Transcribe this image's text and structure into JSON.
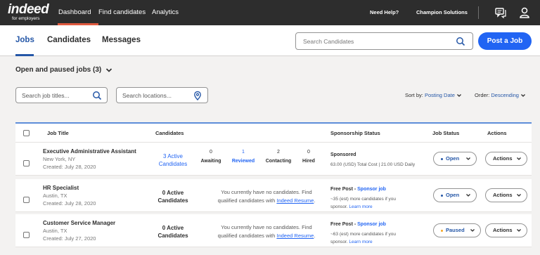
{
  "nav": {
    "logo_main": "indeed",
    "logo_sub": "for employers",
    "links": [
      "Dashboard",
      "Find candidates",
      "Analytics"
    ],
    "need_help": "Need Help?",
    "company": "Champion Solutions",
    "icons": [
      "chat-icon",
      "user-icon"
    ]
  },
  "header": {
    "tabs": [
      "Jobs",
      "Candidates",
      "Messages"
    ],
    "search_placeholder": "Search Candidates",
    "post_job": "Post a Job"
  },
  "filters": {
    "heading": "Open and paused jobs (3)",
    "job_title_placeholder": "Search job titles...",
    "location_placeholder": "Search locations...",
    "sort_label": "Sort by:",
    "sort_value": "Posting Date",
    "order_label": "Order:",
    "order_value": "Descending"
  },
  "table": {
    "columns": [
      "Job Title",
      "Candidates",
      "Sponsorship Status",
      "Job Status",
      "Actions"
    ],
    "rows": [
      {
        "title": "Executive Administrative Assistant",
        "location": "New York, NY",
        "created": "Created: July 28, 2020",
        "candidates_line1": "3 Active",
        "candidates_line2": "Candidates",
        "stats": [
          {
            "num": "0",
            "label": "Awaiting"
          },
          {
            "num": "1",
            "label": "Reviewed"
          },
          {
            "num": "2",
            "label": "Contacting"
          },
          {
            "num": "0",
            "label": "Hired"
          }
        ],
        "sponsorship_title": "Sponsored",
        "sponsorship_detail": "63.00 (USD) Total Cost | 21.00 USD Daily",
        "status": "Open",
        "actions": "Actions"
      },
      {
        "title": "HR Specialist",
        "location": "Austin, TX",
        "created": "Created: July 28, 2020",
        "candidates_line1": "0 Active",
        "candidates_line2": "Candidates",
        "no_candidates_line1": "You currently have no candidates. Find",
        "no_candidates_line2_pre": "qualified candidates with ",
        "no_candidates_link": "Indeed Resume",
        "no_candidates_line2_post": ".",
        "sponsorship_title": "Free Post - ",
        "sponsorship_link": "Sponsor job",
        "sponsorship_detail_line1": "~35 (est) more candidates if you",
        "sponsorship_detail_line2_pre": "sponsor. ",
        "sponsorship_detail_link": "Learn more",
        "status": "Open",
        "actions": "Actions"
      },
      {
        "title": "Customer Service Manager",
        "location": "Austin, TX",
        "created": "Created: July 27, 2020",
        "candidates_line1": "0 Active",
        "candidates_line2": "Candidates",
        "no_candidates_line1": "You currently have no candidates. Find",
        "no_candidates_line2_pre": "qualified candidates with ",
        "no_candidates_link": "Indeed Resume",
        "no_candidates_line2_post": ".",
        "sponsorship_title": "Free Post - ",
        "sponsorship_link": "Sponsor job",
        "sponsorship_detail_line1": "~63 (est) more candidates if you",
        "sponsorship_detail_line2_pre": "sponsor. ",
        "sponsorship_detail_link": "Learn more",
        "status": "Paused",
        "actions": "Actions"
      }
    ]
  },
  "colors": {
    "nav_bg": "#2d2d2d",
    "accent_blue": "#2164f3",
    "nav_active": "#e05a3f",
    "open_dot": "#2557a7",
    "paused_dot": "#f5a623"
  }
}
